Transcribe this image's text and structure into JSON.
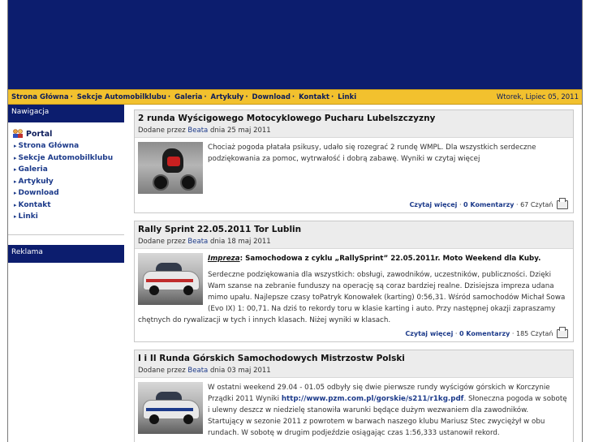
{
  "topbar": {
    "nav": [
      "Strona Główna",
      "Sekcje Automobilklubu",
      "Galeria",
      "Artykuły",
      "Download",
      "Kontakt",
      "Linki"
    ],
    "date": "Wtorek, Lipiec 05, 2011"
  },
  "sidebar": {
    "nav_title": "Nawigacja",
    "portal_label": "Portal",
    "items": [
      "Strona Główna",
      "Sekcje Automobilklubu",
      "Galeria",
      "Artykuły",
      "Download",
      "Kontakt",
      "Linki"
    ],
    "reklama_title": "Reklama"
  },
  "articles": [
    {
      "title": "2 runda Wyścigowego Motocyklowego Pucharu Lubelszczyzny",
      "meta_prefix": "Dodane przez",
      "author": "Beata",
      "meta_date": "dnia 25 maj 2011",
      "body": "Chociaż pogoda płatała psikusy, udało się rozegrać 2 rundę WMPL. Dla wszystkich serdeczne podziękowania za pomoc, wytrwałość i dobrą zabawę. Wyniki w czytaj więcej",
      "read_more": "Czytaj więcej",
      "comments": "0 Komentarzy",
      "reads": "67 Czytań"
    },
    {
      "title": "Rally Sprint 22.05.2011 Tor Lublin",
      "meta_prefix": "Dodane przez",
      "author": "Beata",
      "meta_date": "dnia 18 maj 2011",
      "lead_em": "Impreza",
      "lead_rest": ": Samochodowa z cyklu „RallySprint” 22.05.2011r. Moto Weekend dla Kuby.",
      "body": "Serdeczne podziękowania dla wszystkich: obsługi, zawodników, uczestników, publiczności. Dzięki Wam szanse na zebranie funduszy na operację są coraz bardziej realne. Dzisiejsza impreza udana mimo upału. Najlepsze czasy toPatryk Konowałek (karting) 0:56,31. Wśród samochodów Michał Sowa (Evo IX) 1: 00,71. Na dziś to rekordy toru w klasie karting i auto. Przy następnej okazji zapraszamy chętnych do rywalizacji w tych i innych klasach. Niżej wyniki w klasach.",
      "read_more": "Czytaj więcej",
      "comments": "0 Komentarzy",
      "reads": "185 Czytań"
    },
    {
      "title": "I i II Runda Górskich Samochodowych Mistrzostw Polski",
      "meta_prefix": "Dodane przez",
      "author": "Beata",
      "meta_date": "dnia 03 maj 2011",
      "body_a": "W ostatni weekend 29.04 - 01.05 odbyły się dwie pierwsze rundy wyścigów górskich w Korczynie Prządki 2011 Wyniki ",
      "link": "http://www.pzm.com.pl/gorskie/s211/r1kg.pdf",
      "body_b": ". Słoneczna pogoda w sobotę i ulewny deszcz w niedzielę stanowiła warunki będące dużym wezwaniem dla zawodników.",
      "body_c": "Startujący w sezonie 2011 z powrotem w barwach naszego klubu Mariusz Stec zwyciężył w obu rundach. W sobotę w drugim podjeździe osiągając czas 1:56,333 ustanowił rekord."
    }
  ]
}
